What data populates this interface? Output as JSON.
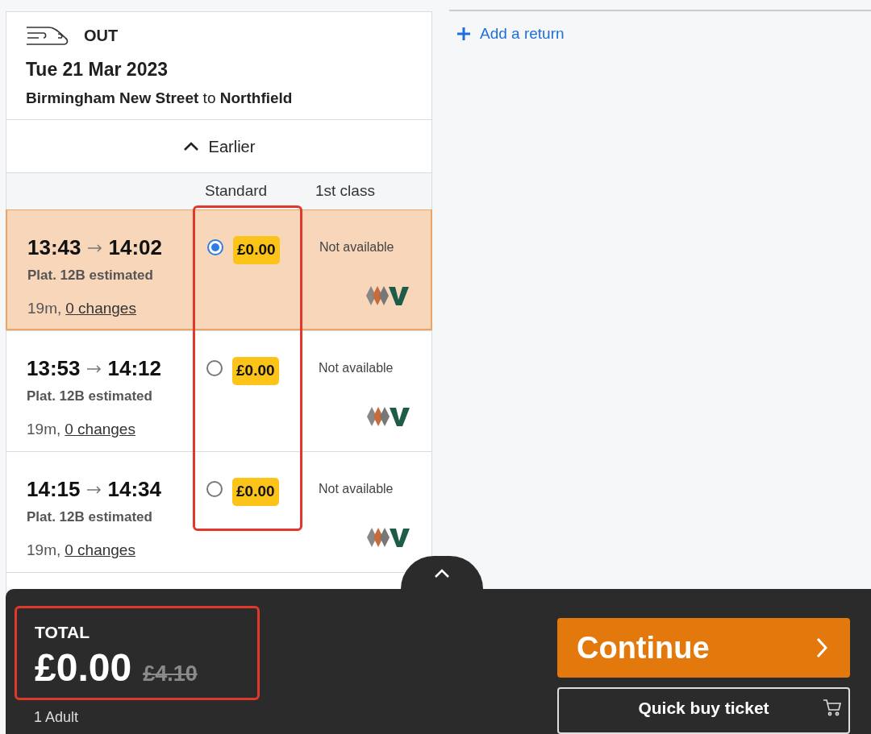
{
  "journey": {
    "direction": "OUT",
    "date": "Tue 21 Mar 2023",
    "origin": "Birmingham New Street",
    "connector": "to",
    "destination": "Northfield"
  },
  "earlier": {
    "label": "Earlier"
  },
  "columns": [
    "Standard",
    "1st class"
  ],
  "rows": [
    {
      "depart": "13:43",
      "arrive": "14:02",
      "platform": "Plat. 12B estimated",
      "duration": "19m,",
      "changes": "0 changes",
      "standard_price": "£0.00",
      "first_class": "Not available",
      "selected": true
    },
    {
      "depart": "13:53",
      "arrive": "14:12",
      "platform": "Plat. 12B estimated",
      "duration": "19m,",
      "changes": "0 changes",
      "standard_price": "£0.00",
      "first_class": "Not available",
      "selected": false
    },
    {
      "depart": "14:15",
      "arrive": "14:34",
      "platform": "Plat. 12B estimated",
      "duration": "19m,",
      "changes": "0 changes",
      "standard_price": "£0.00",
      "first_class": "Not available",
      "selected": false
    }
  ],
  "add_return": {
    "label": "Add a return"
  },
  "basket": {
    "total_label": "TOTAL",
    "total": "£0.00",
    "original_price": "£4.10",
    "passengers": "1 Adult",
    "continue": "Continue",
    "quick_buy": "Quick buy ticket"
  }
}
